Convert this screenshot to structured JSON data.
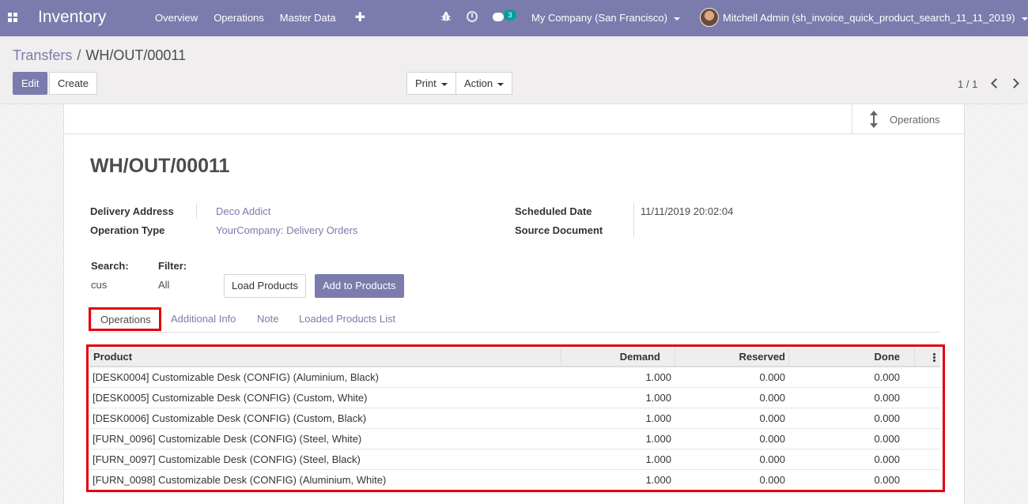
{
  "navbar": {
    "brand": "Inventory",
    "menu": [
      "Overview",
      "Operations",
      "Master Data"
    ],
    "plus": "✚",
    "chat_count": "3",
    "company": "My Company (San Francisco)",
    "user": "Mitchell Admin (sh_invoice_quick_product_search_11_11_2019)",
    "color": "#7c7bad"
  },
  "breadcrumb": {
    "parent": "Transfers",
    "separator": "/",
    "current": "WH/OUT/00011"
  },
  "toolbar": {
    "edit": "Edit",
    "create": "Create",
    "print": "Print",
    "action": "Action"
  },
  "pager": {
    "value": "1 / 1"
  },
  "smart_button": {
    "label": "Operations",
    "icon": "arrows-v-icon"
  },
  "record": {
    "title": "WH/OUT/00011"
  },
  "fields": {
    "delivery_address_label": "Delivery Address",
    "delivery_address": "Deco Addict",
    "operation_type_label": "Operation Type",
    "operation_type": "YourCompany: Delivery Orders",
    "scheduled_date_label": "Scheduled Date",
    "scheduled_date": "11/11/2019 20:02:04",
    "source_document_label": "Source Document",
    "source_document": ""
  },
  "search": {
    "search_label": "Search:",
    "search_value": "cus",
    "filter_label": "Filter:",
    "filter_value": "All",
    "load_button": "Load Products",
    "add_button": "Add to Products"
  },
  "tabs": [
    "Operations",
    "Additional Info",
    "Note",
    "Loaded Products List"
  ],
  "table": {
    "headers": {
      "product": "Product",
      "demand": "Demand",
      "reserved": "Reserved",
      "done": "Done"
    },
    "rows": [
      {
        "product": "[DESK0004] Customizable Desk (CONFIG) (Aluminium, Black)",
        "demand": "1.000",
        "reserved": "0.000",
        "done": "0.000"
      },
      {
        "product": "[DESK0005] Customizable Desk (CONFIG) (Custom, White)",
        "demand": "1.000",
        "reserved": "0.000",
        "done": "0.000"
      },
      {
        "product": "[DESK0006] Customizable Desk (CONFIG) (Custom, Black)",
        "demand": "1.000",
        "reserved": "0.000",
        "done": "0.000"
      },
      {
        "product": "[FURN_0096] Customizable Desk (CONFIG) (Steel, White)",
        "demand": "1.000",
        "reserved": "0.000",
        "done": "0.000"
      },
      {
        "product": "[FURN_0097] Customizable Desk (CONFIG) (Steel, Black)",
        "demand": "1.000",
        "reserved": "0.000",
        "done": "0.000"
      },
      {
        "product": "[FURN_0098] Customizable Desk (CONFIG) (Aluminium, White)",
        "demand": "1.000",
        "reserved": "0.000",
        "done": "0.000"
      }
    ]
  },
  "highlight_color": "#e3000f"
}
